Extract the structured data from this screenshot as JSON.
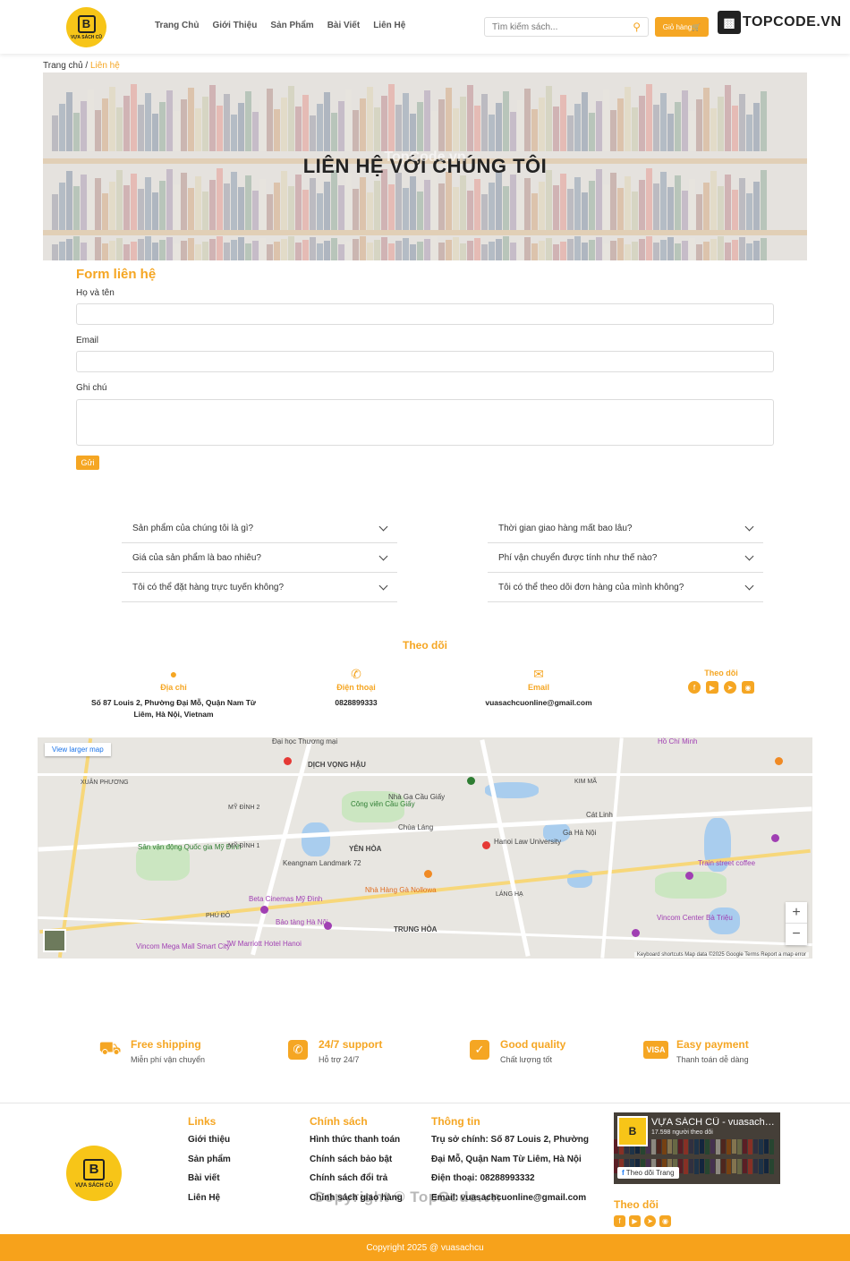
{
  "header": {
    "logo_text": "VỰA SÁCH CŨ",
    "nav": [
      "Trang Chủ",
      "Giới Thiệu",
      "Sản Phẩm",
      "Bài Viết",
      "Liên Hệ"
    ],
    "search_placeholder": "Tìm kiếm sách...",
    "cart_label": "Giỏ hàng",
    "watermark_logo": "TOPCODE.VN"
  },
  "breadcrumb": {
    "home": "Trang chủ",
    "sep": " / ",
    "current": "Liên hệ"
  },
  "hero": {
    "title": "LIÊN HỆ VỚI CHÚNG TÔI",
    "watermark": "TopCode.vn"
  },
  "form": {
    "title": "Form liên hệ",
    "name_label": "Họ và tên",
    "email_label": "Email",
    "note_label": "Ghi chú",
    "submit_label": "Gửi"
  },
  "faq": [
    "Sản phẩm của chúng tôi là gì?",
    "Thời gian giao hàng mất bao lâu?",
    "Giá của sản phẩm là bao nhiêu?",
    "Phí vận chuyển được tính như thế nào?",
    "Tôi có thể đặt hàng trực tuyến không?",
    "Tôi có thể theo dõi đơn hàng của mình không?"
  ],
  "contact": {
    "section_title": "Theo dõi",
    "address_label": "Địa chỉ",
    "address_value": "Số 87 Louis 2, Phường Đại Mỗ, Quận Nam Từ Liêm, Hà Nội, Vietnam",
    "phone_label": "Điện thoại",
    "phone_value": "0828899333",
    "email_label": "Email",
    "email_value": "vuasachcuonline@gmail.com",
    "follow_label": "Theo dõi"
  },
  "map": {
    "view_larger": "View larger map",
    "attribution": "Keyboard shortcuts   Map data ©2025 Google   Terms   Report a map error",
    "labels": [
      "DỊCH VỌNG HẬU",
      "YÊN HÒA",
      "Hanoi Law University",
      "Keangnam Landmark 72",
      "Beta Cinemas Mỹ Đình",
      "Bảo tàng Hà Nội",
      "Sân vận động Quốc gia Mỹ Đình",
      "Công viên Cầu Giấy",
      "Nhà Ga Cầu Giấy",
      "Chùa Láng",
      "TRUNG HÒA",
      "Đại học Thương mại",
      "Hồ Chí Minh",
      "Vincom Center Bà Triệu",
      "Train street coffee",
      "Cát Linh",
      "Ga Hà Nội",
      "Nhà Hàng Gà Nollowa",
      "JW Marriott Hotel Hanoi",
      "Vincom Mega Mall Smart City",
      "XUÂN PHƯƠNG",
      "MỸ ĐÌNH 2",
      "MỸ ĐÌNH 1",
      "PHÚ ĐÔ",
      "LÁNG HẠ",
      "KIM MÃ"
    ]
  },
  "features": [
    {
      "title": "Free shipping",
      "sub": "Miễn phí vận chuyển",
      "icon": "truck-icon"
    },
    {
      "title": "24/7 support",
      "sub": "Hỗ trợ 24/7",
      "icon": "phone-icon"
    },
    {
      "title": "Good quality",
      "sub": "Chất lượng tốt",
      "icon": "check-icon"
    },
    {
      "title": "Easy payment",
      "sub": "Thanh toán dễ dàng",
      "icon": "visa-icon"
    }
  ],
  "footer": {
    "logo_text": "VỰA SÁCH CŨ",
    "links_title": "Links",
    "links": [
      "Giới thiệu",
      "Sản phẩm",
      "Bài viết",
      "Liên Hệ"
    ],
    "policy_title": "Chính sách",
    "policies": [
      "Hình thức thanh toán",
      "Chính sách bảo bật",
      "Chính sách đổi trả",
      "Chính sách giao hàng"
    ],
    "info_title": "Thông tin",
    "info": [
      "Trụ sở chính: Số 87 Louis 2, Phường",
      "Đại Mỗ, Quận Nam Từ Liêm, Hà Nội",
      "Điện thoại: 08288993332",
      "Email: vuasachcuonline@gmail.com"
    ],
    "fb_name": "VỰA SÁCH CŨ - vuasachcu",
    "fb_followers": "17.598 người theo dõi",
    "fb_button": "Theo dõi Trang",
    "follow_title": "Theo dõi",
    "watermark": "Copyright © TopCode.vn",
    "copyright": "Copyright 2025 @ vuasachcu"
  },
  "colors": {
    "accent": "#f5a623",
    "footer_bar": "#f7a21b"
  }
}
